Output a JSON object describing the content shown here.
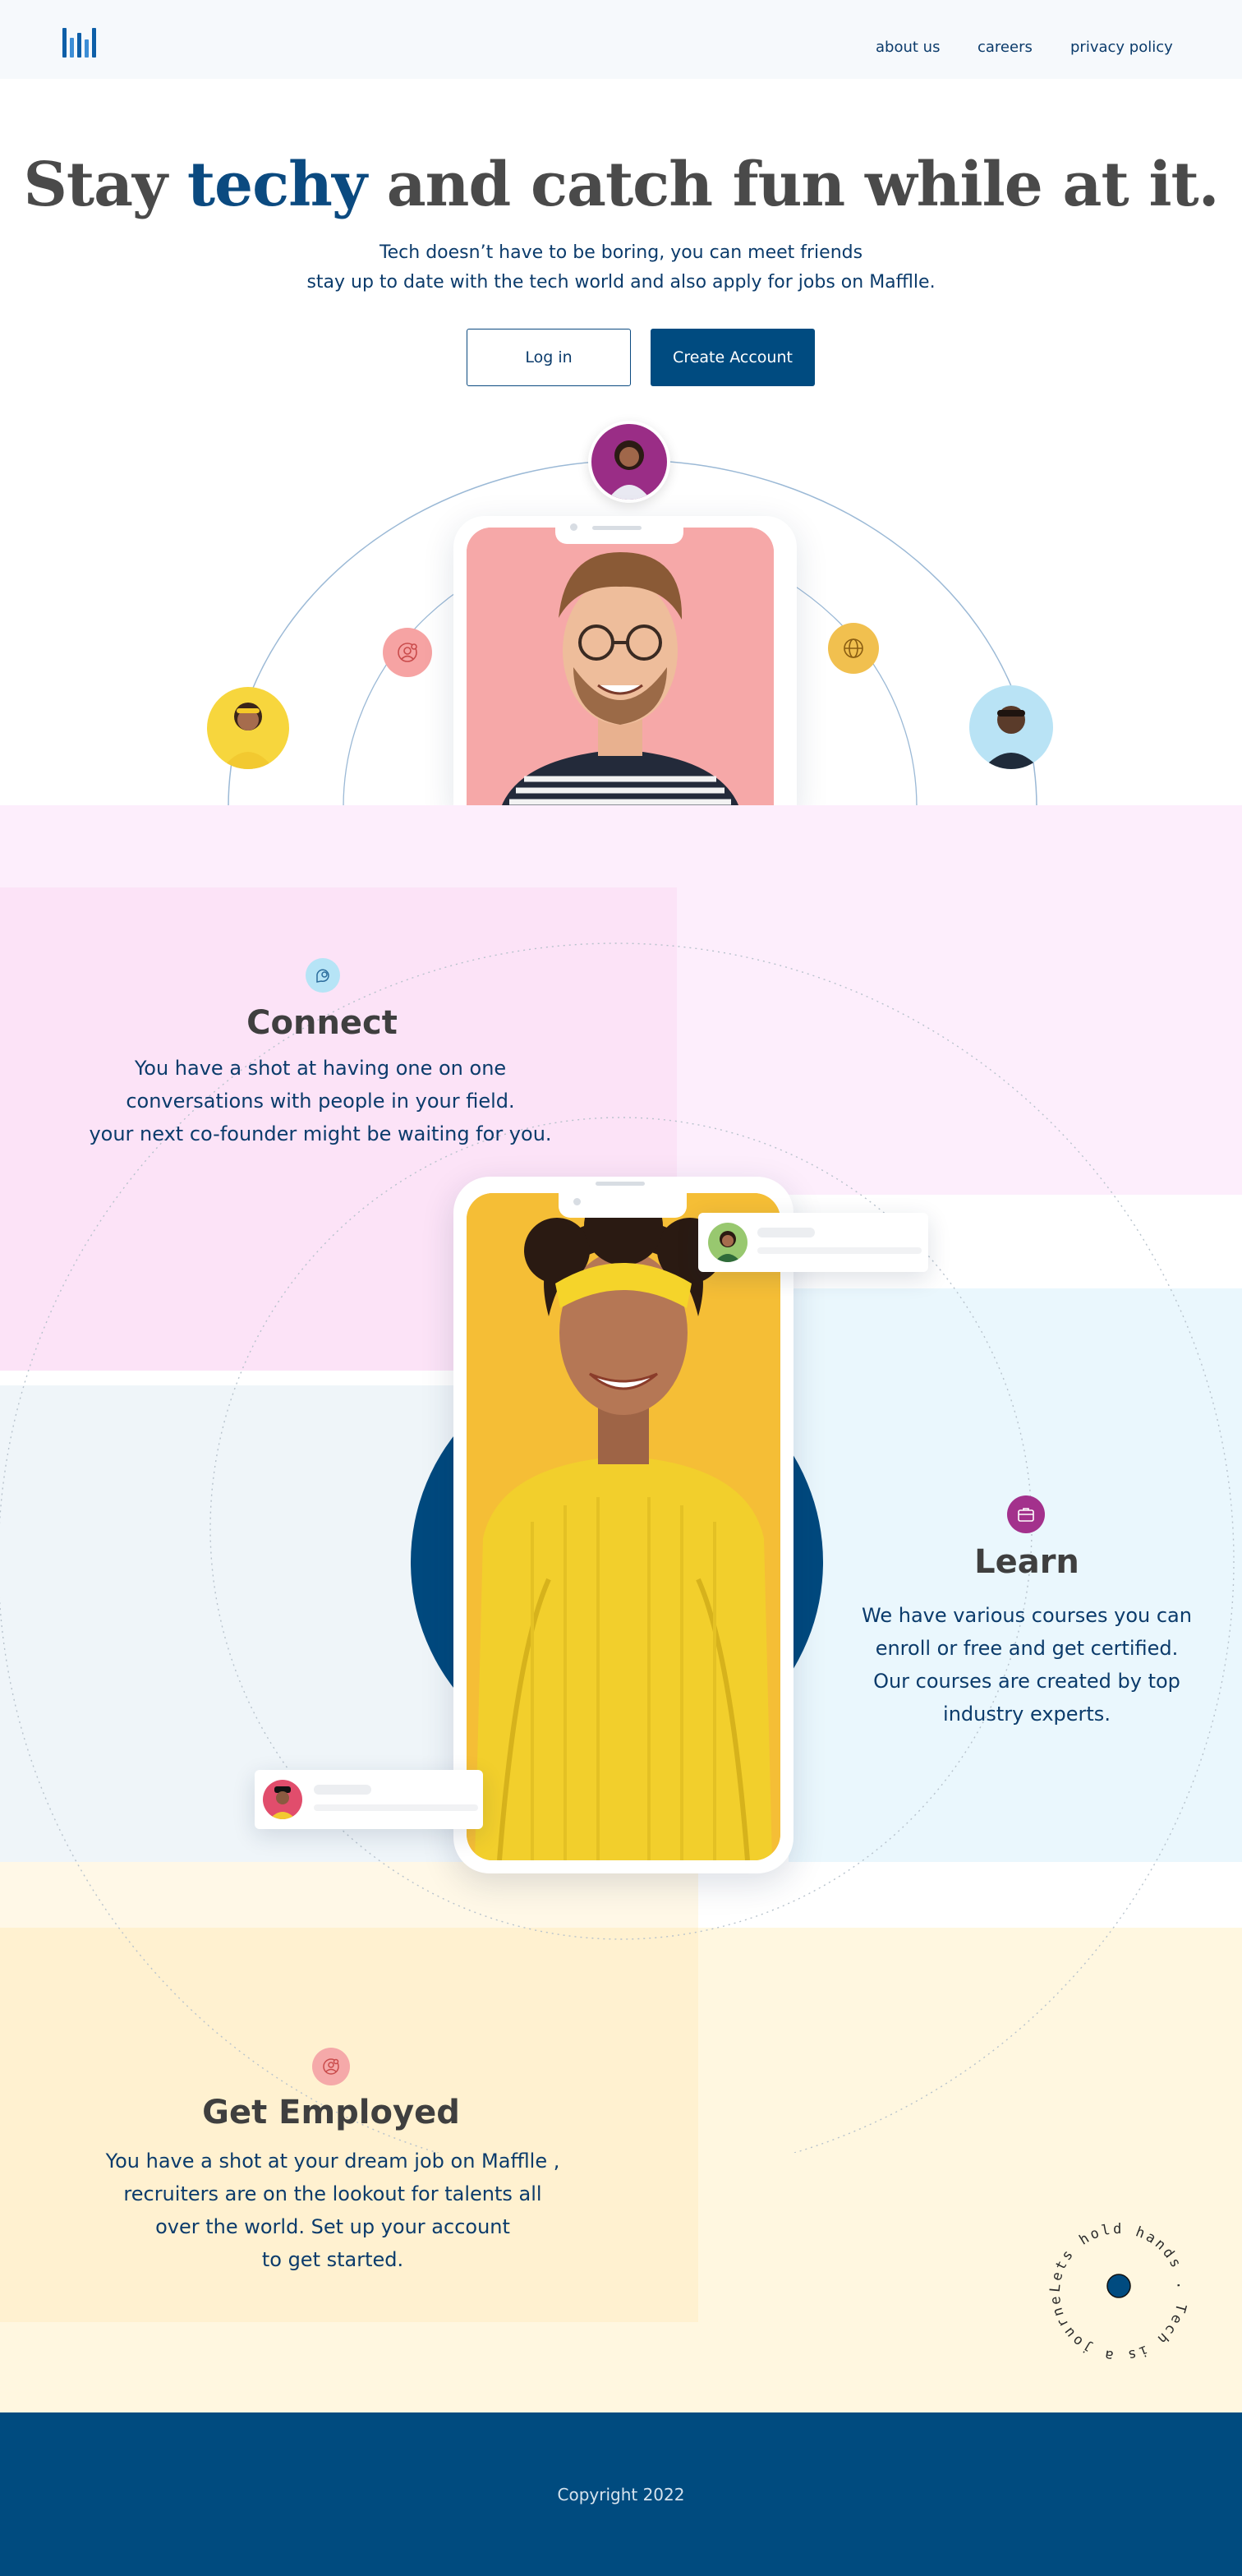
{
  "nav": {
    "logo": "logo-bars",
    "links": [
      "about us",
      "careers",
      "privacy policy"
    ]
  },
  "hero": {
    "title_pre": "Stay ",
    "title_accent": "techy",
    "title_post": " and catch fun while at it.",
    "subtitle_line1": "Tech doesn’t have to be  boring, you can meet friends",
    "subtitle_line2": "stay up to date with the tech world and also apply for jobs on Mafflle.",
    "login_label": "Log in",
    "create_label": "Create Account"
  },
  "features": {
    "connect": {
      "icon": "chat-icon",
      "title": "Connect",
      "lines": [
        "You have a shot at having one on one",
        "conversations with people in your field.",
        "your next co-founder might be waiting for you."
      ]
    },
    "learn": {
      "icon": "briefcase-icon",
      "title": "Learn",
      "lines": [
        "We have various courses you can",
        "enroll or free and get certified.",
        "Our courses are created by top",
        "industry experts."
      ]
    },
    "employed": {
      "icon": "user-badge-icon",
      "title": "Get  Employed",
      "lines": [
        "You have a shot at your dream job on Mafflle ,",
        "recruiters are on the lookout for talents all",
        "over the world. Set up your account",
        "to get started."
      ]
    }
  },
  "stamp": {
    "text": "Lets hold hands . Tech is a journey ."
  },
  "footer": {
    "copyright": "Copyright 2022"
  },
  "colors": {
    "navy": "#004b80",
    "accent_blue": "#0b4a80",
    "pink_panel": "#fce3f7",
    "blue_panel": "#eaf7fd",
    "yellow_panel": "#fff1d0"
  }
}
